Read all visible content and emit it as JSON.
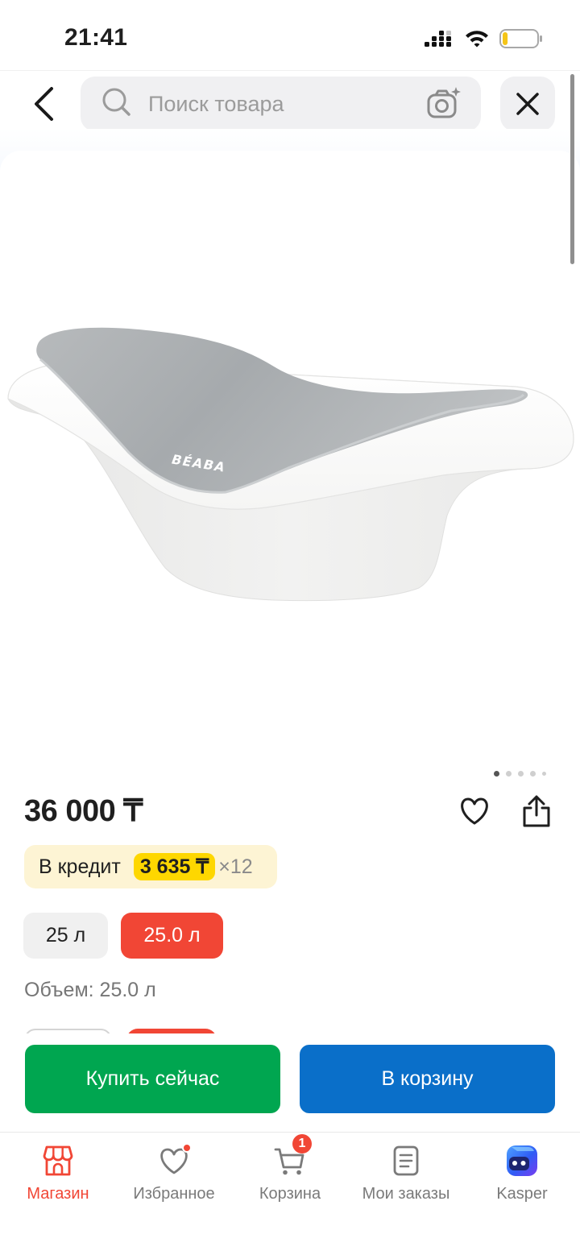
{
  "status_bar": {
    "time": "21:41",
    "signal_icon": "cellular-signal-icon",
    "wifi_icon": "wifi-icon",
    "battery_icon": "battery-icon",
    "battery_level": 0.15,
    "battery_color": "#f5c518"
  },
  "header": {
    "back_icon": "chevron-left-icon",
    "search": {
      "placeholder": "Поиск товара",
      "value": "",
      "search_icon": "search-icon",
      "camera_icon": "camera-sparkle-icon"
    },
    "close_icon": "close-icon"
  },
  "gallery": {
    "brand_mark": "BÉABA",
    "image_count": 5,
    "current_image": 1
  },
  "product": {
    "price": "36 000 ₸",
    "favorite_icon": "heart-outline-icon",
    "share_icon": "share-icon",
    "credit": {
      "label": "В кредит",
      "monthly": "3 635 ₸",
      "months": "×12"
    },
    "variants": [
      {
        "label": "25 л",
        "selected": false
      },
      {
        "label": "25.0 л",
        "selected": true
      }
    ],
    "selected_attribute": "Объем: 25.0 л"
  },
  "actions": {
    "buy_now": "Купить сейчас",
    "add_to_cart": "В корзину"
  },
  "tab_bar": {
    "items": [
      {
        "label": "Магазин",
        "icon": "shop-icon",
        "active": true
      },
      {
        "label": "Избранное",
        "icon": "heart-icon",
        "active": false,
        "notification_dot": true
      },
      {
        "label": "Корзина",
        "icon": "cart-icon",
        "active": false,
        "badge": "1"
      },
      {
        "label": "Мои заказы",
        "icon": "orders-icon",
        "active": false
      },
      {
        "label": "Kasper",
        "icon": "kasper-icon",
        "active": false
      }
    ]
  },
  "colors": {
    "accent_red": "#f14635",
    "buy_green": "#00a650",
    "cart_blue": "#0a6fc9",
    "credit_bg": "#fdf4d4",
    "credit_highlight": "#fed700",
    "text_primary": "#1f1f1f",
    "text_secondary": "#767676"
  }
}
